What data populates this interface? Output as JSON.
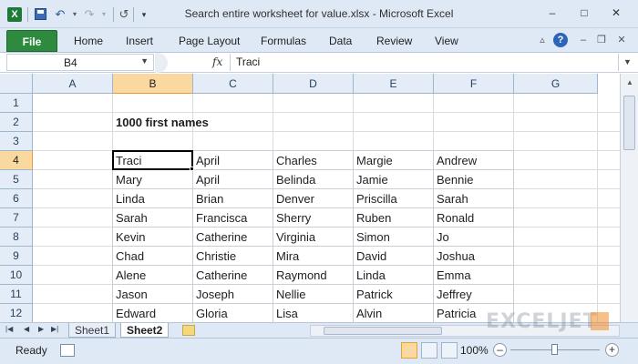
{
  "window": {
    "title": "Search entire worksheet for value.xlsx - Microsoft Excel",
    "app_icon": "X",
    "controls": [
      "minimize-icon",
      "maximize-icon",
      "close-icon"
    ]
  },
  "quick_access": {
    "items": [
      "save-icon",
      "undo-icon",
      "redo-icon",
      "customize-icon"
    ]
  },
  "ribbon": {
    "file_label": "File",
    "tabs": [
      "Home",
      "Insert",
      "Page Layout",
      "Formulas",
      "Data",
      "Review",
      "View"
    ]
  },
  "formula_bar": {
    "name_box": "B4",
    "fx_label": "fx",
    "value": "Traci"
  },
  "grid": {
    "columns": [
      "A",
      "B",
      "C",
      "D",
      "E",
      "F",
      "G"
    ],
    "selected_column": "B",
    "rows": [
      "1",
      "2",
      "3",
      "4",
      "5",
      "6",
      "7",
      "8",
      "9",
      "10",
      "11",
      "12"
    ],
    "selected_row": "4",
    "title": "1000 first names",
    "names": [
      [
        "Traci",
        "April",
        "Charles",
        "Margie",
        "Andrew"
      ],
      [
        "Mary",
        "April",
        "Belinda",
        "Jamie",
        "Bennie"
      ],
      [
        "Linda",
        "Brian",
        "Denver",
        "Priscilla",
        "Sarah"
      ],
      [
        "Sarah",
        "Francisca",
        "Sherry",
        "Ruben",
        "Ronald"
      ],
      [
        "Kevin",
        "Catherine",
        "Virginia",
        "Simon",
        "Jo"
      ],
      [
        "Chad",
        "Christie",
        "Mira",
        "David",
        "Joshua"
      ],
      [
        "Alene",
        "Catherine",
        "Raymond",
        "Linda",
        "Emma"
      ],
      [
        "Jason",
        "Joseph",
        "Nellie",
        "Patrick",
        "Jeffrey"
      ],
      [
        "Edward",
        "Gloria",
        "Lisa",
        "Alvin",
        "Patricia"
      ]
    ]
  },
  "sheets": {
    "tabs": [
      "Sheet1",
      "Sheet2"
    ],
    "active": "Sheet2"
  },
  "status": {
    "ready": "Ready",
    "zoom": "100%",
    "zoom_level_fraction": 0.5
  },
  "watermark": "EXCELJET"
}
